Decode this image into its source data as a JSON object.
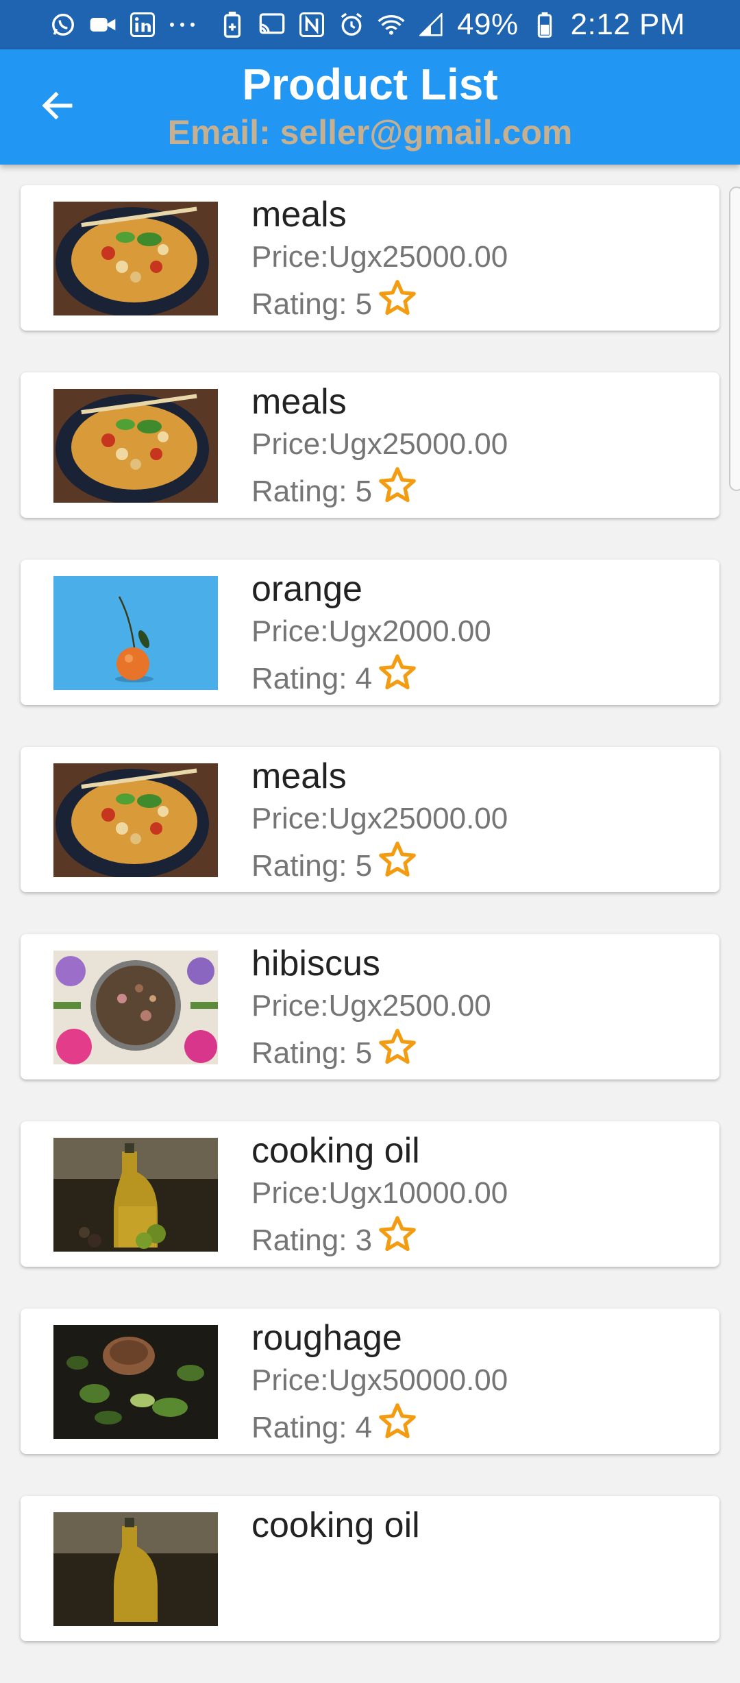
{
  "status_bar": {
    "battery": "49%",
    "time": "2:12 PM",
    "icons_left": [
      "whatsapp-icon",
      "video-icon",
      "linkedin-icon",
      "more-dots-icon"
    ],
    "icons_right": [
      "battery-saver-icon",
      "cast-icon",
      "nfc-icon",
      "alarm-icon",
      "wifi-icon",
      "signal-icon",
      "battery-icon"
    ]
  },
  "app_bar": {
    "title": "Product List",
    "subtitle": "Email: seller@gmail.com",
    "back_icon": "arrow-back-icon"
  },
  "colors": {
    "status_bar": "#1e64b0",
    "app_bar": "#2196f3",
    "subtitle": "#c7b08f",
    "star": "#f39c12"
  },
  "products": [
    {
      "name": "meals",
      "price": "Price:Ugx25000.00",
      "rating": "Rating: 5",
      "image": "meals"
    },
    {
      "name": "meals",
      "price": "Price:Ugx25000.00",
      "rating": "Rating: 5",
      "image": "meals"
    },
    {
      "name": "orange",
      "price": "Price:Ugx2000.00",
      "rating": "Rating: 4",
      "image": "orange"
    },
    {
      "name": "meals",
      "price": "Price:Ugx25000.00",
      "rating": "Rating: 5",
      "image": "meals"
    },
    {
      "name": "hibiscus",
      "price": "Price:Ugx2500.00",
      "rating": "Rating: 5",
      "image": "hibiscus"
    },
    {
      "name": "cooking oil",
      "price": "Price:Ugx10000.00",
      "rating": "Rating: 3",
      "image": "oil"
    },
    {
      "name": "roughage",
      "price": "Price:Ugx50000.00",
      "rating": "Rating: 4",
      "image": "roughage"
    },
    {
      "name": "cooking oil",
      "price": "",
      "rating": "",
      "image": "oil"
    }
  ]
}
